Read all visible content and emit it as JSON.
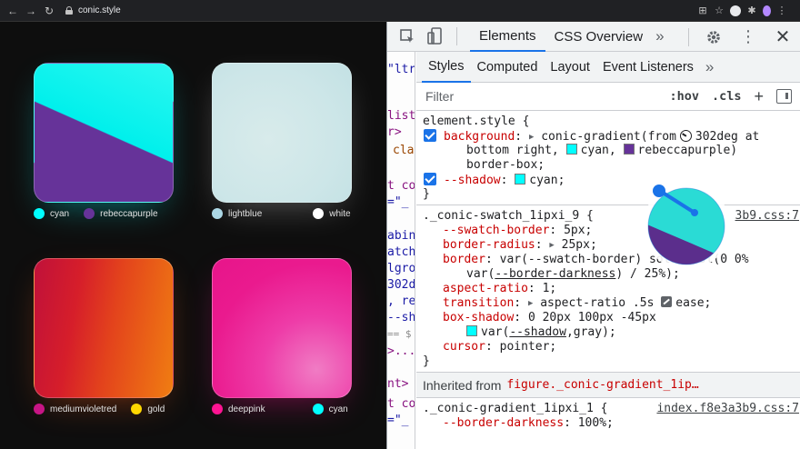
{
  "browser": {
    "url": "conic.style",
    "nav": {
      "back": "←",
      "forward": "→",
      "reload": "↻"
    }
  },
  "page": {
    "swatches": [
      {
        "labels": [
          "cyan",
          "rebeccapurple"
        ],
        "dots": [
          "#00ffff",
          "#663399"
        ]
      },
      {
        "labels": [
          "lightblue",
          "white"
        ],
        "dots": [
          "#add8e6",
          "#ffffff"
        ]
      },
      {
        "labels": [
          "mediumvioletred",
          "gold"
        ],
        "dots": [
          "#c71585",
          "#ffd700"
        ]
      },
      {
        "labels": [
          "deeppink",
          "cyan"
        ],
        "dots": [
          "#ff1493",
          "#00ffff"
        ]
      }
    ]
  },
  "devtools": {
    "main_tabs": [
      "Elements",
      "CSS Overview"
    ],
    "active_main_tab": "Elements",
    "more_tabs": "»",
    "sub_tabs": [
      "Styles",
      "Computed",
      "Layout",
      "Event Listeners"
    ],
    "active_sub_tab": "Styles",
    "filter_placeholder": "Filter",
    "hov": ":hov",
    "cls": ".cls",
    "plus": "+",
    "dom_fragments": [
      "\"ltr",
      "list",
      "r> ",
      "cla",
      "t co",
      "=\"_",
      "abind",
      "atch_",
      "lgrou",
      "302d",
      ", re",
      "--sh",
      "== $",
      ">...</",
      "nt>",
      "t co",
      "=\"_"
    ],
    "element_style": {
      "selector": "element.style {",
      "background_prop": "background",
      "background_val_1": "conic-gradient(from",
      "angle": "302deg at",
      "background_val_2": "bottom right,",
      "cyan": "cyan,",
      "rebecca": "rebeccapurple)",
      "background_val_3": "border-box;",
      "shadow_prop": "--shadow",
      "shadow_val": "cyan;",
      "close": "}"
    },
    "swatch_rule": {
      "selector": "._conic-swatch_1ipxi_9 {",
      "source": "3b9.css:7",
      "lines": [
        {
          "prop": "--swatch-border",
          "val": "5px;"
        },
        {
          "prop": "border-radius",
          "val": "25px;"
        },
        {
          "prop": "border",
          "val": "var(--swatch-border) solid hsl(0 0%"
        },
        {
          "prop": "aspect-ratio",
          "val": "1;"
        },
        {
          "prop": "transition",
          "val": "aspect-ratio .5s"
        },
        {
          "prop": "box-shadow",
          "val": "0 20px 100px -45px"
        },
        {
          "prop": "cursor",
          "val": "pointer;"
        }
      ],
      "border_cont_pre": "var(",
      "border_cont_var": "--border-darkness",
      "border_cont_post": ") / 25%);",
      "transition_ease": "ease;",
      "shadow_cont_pre": "var(",
      "shadow_cont_var": "--shadow",
      "shadow_cont_post": ",gray);",
      "close": "}"
    },
    "inherited": {
      "label": "Inherited from",
      "selector": "figure._conic-gradient_1ip…"
    },
    "gradient_rule": {
      "selector": "._conic-gradient_1ipxi_1 {",
      "source": "index.f8e3a3b9.css:7",
      "prop": "--border-darkness",
      "val": "100%;"
    }
  },
  "colors": {
    "cyan": "#00ffff",
    "rebeccapurple": "#663399",
    "accent": "#1a73e8"
  }
}
